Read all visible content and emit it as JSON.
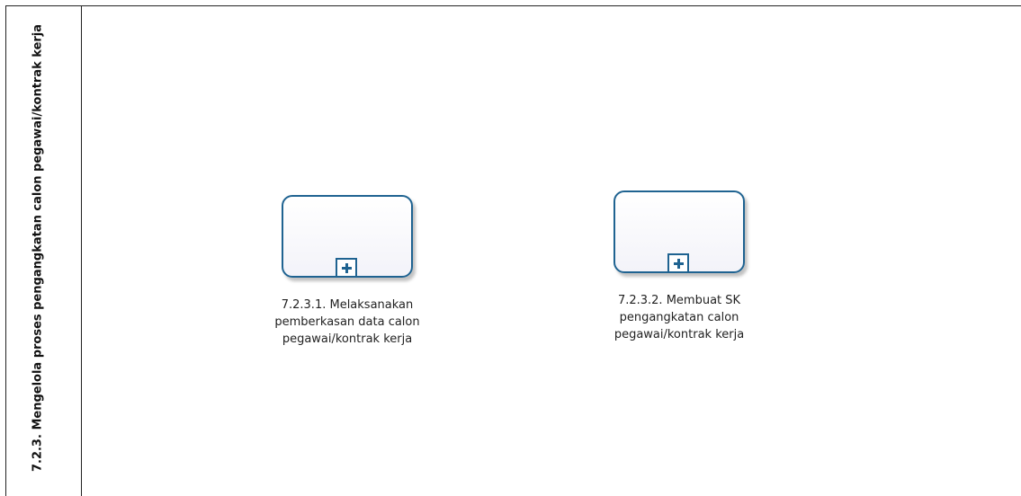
{
  "lane": {
    "title": "7.2.3. Mengelola proses pengangkatan calon pegawai/kontrak kerja"
  },
  "tasks": [
    {
      "label": "7.2.3.1. Melaksanakan\npemberkasan data calon\npegawai/kontrak kerja",
      "marker": "collapsed-subprocess-plus-icon"
    },
    {
      "label": "7.2.3.2. Membuat SK\npengangkatan calon\npegawai/kontrak kerja",
      "marker": "collapsed-subprocess-plus-icon"
    }
  ],
  "colors": {
    "task_border": "#1f6391",
    "lane_border": "#222222",
    "task_fill": "#f3f3f9"
  }
}
